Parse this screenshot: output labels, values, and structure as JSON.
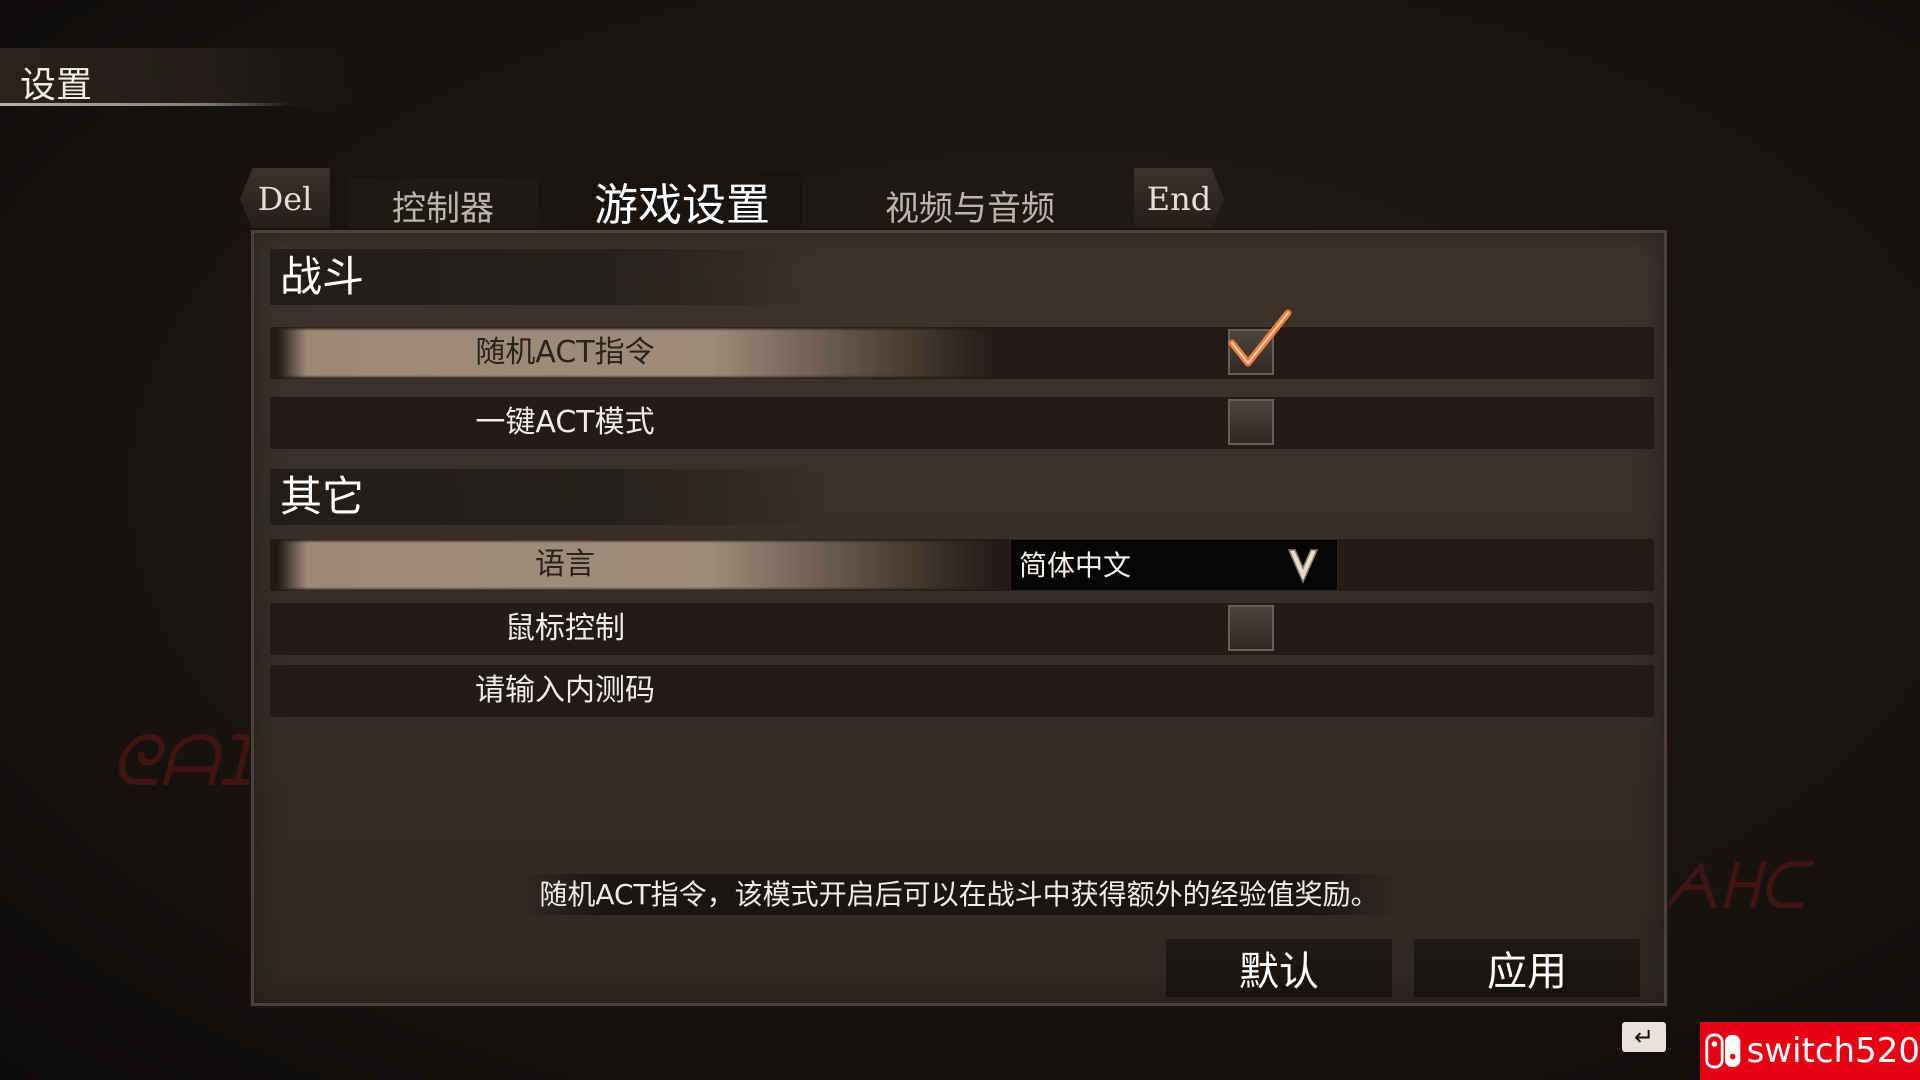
{
  "page": {
    "title": "设置"
  },
  "tabs": {
    "prev_key": "Del",
    "next_key": "End",
    "items": [
      {
        "label": "控制器",
        "active": false
      },
      {
        "label": "游戏设置",
        "active": true
      },
      {
        "label": "视频与音频",
        "active": false
      }
    ]
  },
  "sections": {
    "combat": {
      "header": "战斗",
      "rows": [
        {
          "label": "随机ACT指令",
          "control": "checkbox",
          "checked": true,
          "highlighted": true
        },
        {
          "label": "一键ACT模式",
          "control": "checkbox",
          "checked": false,
          "highlighted": false
        }
      ]
    },
    "other": {
      "header": "其它",
      "rows": [
        {
          "label": "语言",
          "control": "dropdown",
          "value": "简体中文",
          "highlighted": true
        },
        {
          "label": "鼠标控制",
          "control": "checkbox",
          "checked": false,
          "highlighted": false
        },
        {
          "label": "请输入内测码",
          "control": "input",
          "highlighted": false
        }
      ]
    }
  },
  "hint_text": "随机ACT指令，该模式开启后可以在战斗中获得额外的经验值奖励。",
  "buttons": {
    "default": "默认",
    "apply": "应用"
  },
  "watermark": {
    "brand": "switch520"
  },
  "icons": {
    "checkmark": "checkmark-icon",
    "dropdown": "chevron-down-icon",
    "enter": "enter-key-icon",
    "switch": "switch-logo-icon"
  },
  "colors": {
    "accent_check": "#f07a3a",
    "brand_red": "#e60012"
  }
}
